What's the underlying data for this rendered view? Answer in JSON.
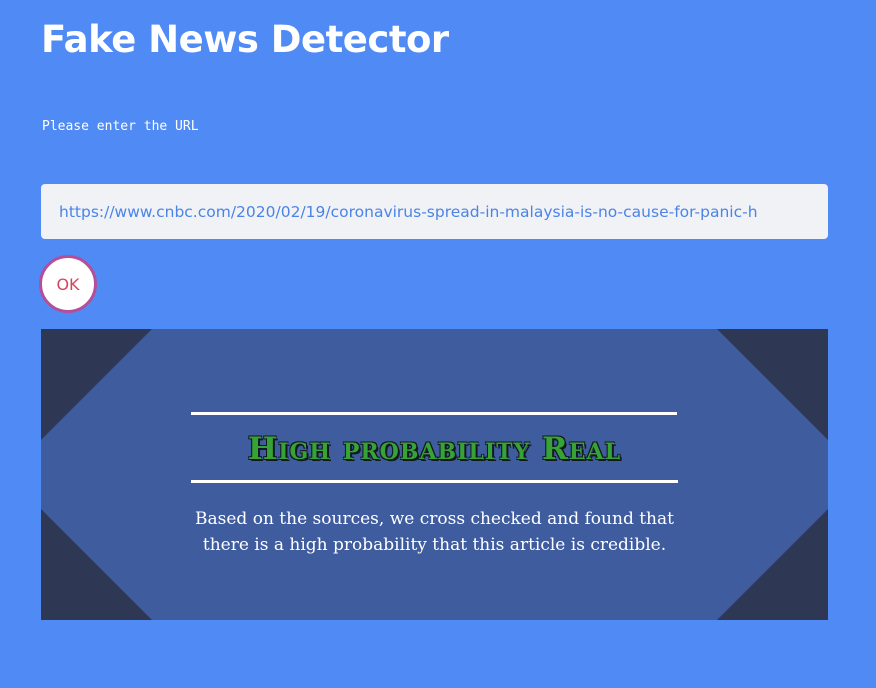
{
  "app": {
    "title": "Fake News Detector"
  },
  "form": {
    "prompt": "Please enter the URL",
    "url_value": "https://www.cnbc.com/2020/02/19/coronavirus-spread-in-malaysia-is-no-cause-for-panic-h",
    "ok_label": "OK"
  },
  "result": {
    "verdict": "High probability Real",
    "explanation": "Based on the sources, we cross checked and found that there is a high probability that this article is credible."
  },
  "colors": {
    "background": "#4f8af5",
    "panel_dark": "#2e3753",
    "panel_main": "#3f5c9f",
    "verdict_green": "#37a235",
    "ok_border": "#b34e9a",
    "ok_text": "#d6455b"
  }
}
